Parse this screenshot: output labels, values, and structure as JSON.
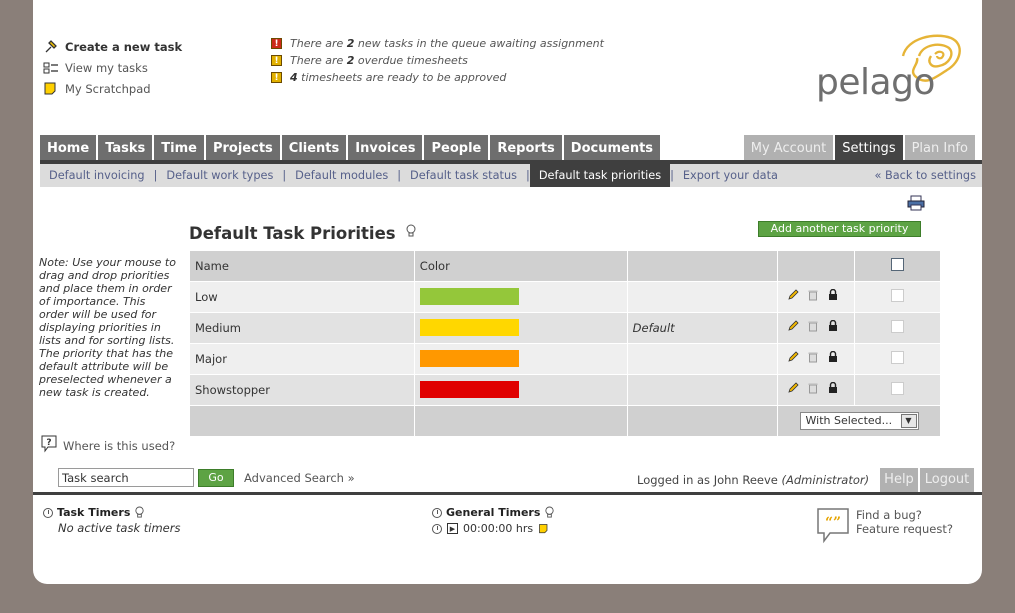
{
  "quick_links": [
    {
      "label": "Create a new task",
      "bold": true
    },
    {
      "label": "View my tasks",
      "bold": false
    },
    {
      "label": "My Scratchpad",
      "bold": false
    }
  ],
  "notices": [
    {
      "pre": "There are ",
      "num": "2",
      "post": " new tasks in the queue awaiting assignment",
      "color": "#cc2a1a"
    },
    {
      "pre": "There are ",
      "num": "2",
      "post": " overdue timesheets",
      "color": "#e2b100"
    },
    {
      "pre": "",
      "num": "4",
      "post": " timesheets are ready to be approved",
      "color": "#e2b100"
    }
  ],
  "logo": {
    "text": "pelago"
  },
  "main_nav": [
    "Home",
    "Tasks",
    "Time",
    "Projects",
    "Clients",
    "Invoices",
    "People",
    "Reports",
    "Documents"
  ],
  "right_nav": [
    {
      "label": "My Account",
      "active": false
    },
    {
      "label": "Settings",
      "active": true
    },
    {
      "label": "Plan Info",
      "active": false
    }
  ],
  "sub_nav": [
    {
      "label": "Default invoicing",
      "active": false
    },
    {
      "label": "Default work types",
      "active": false
    },
    {
      "label": "Default modules",
      "active": false
    },
    {
      "label": "Default task status",
      "active": false
    },
    {
      "label": "Default task priorities",
      "active": true
    },
    {
      "label": "Export your data",
      "active": false
    }
  ],
  "back_link": "« Back to settings",
  "page_title": "Default Task Priorities",
  "add_button": "Add another task priority",
  "note": "Note: Use your mouse to drag and drop priorities and place them in order of importance. This order will be used for displaying priorities in lists and for sorting lists. The priority that has the default attribute will be preselected whenever a new task is created.",
  "where_used": "Where is this used?",
  "table": {
    "headers": [
      "Name",
      "Color"
    ],
    "rows": [
      {
        "name": "Low",
        "color": "#94c73a",
        "default": ""
      },
      {
        "name": "Medium",
        "color": "#ffd700",
        "default": "Default"
      },
      {
        "name": "Major",
        "color": "#ff9800",
        "default": ""
      },
      {
        "name": "Showstopper",
        "color": "#e00000",
        "default": ""
      }
    ],
    "with_selected": "With Selected..."
  },
  "search": {
    "value": "Task search",
    "go": "Go",
    "advanced": "Advanced Search »"
  },
  "logged_in": {
    "prefix": "Logged in as John Reeve ",
    "role": "(Administrator)"
  },
  "help": "Help",
  "logout": "Logout",
  "timers": {
    "task_title": "Task Timers",
    "task_none": "No active task timers",
    "general_title": "General Timers",
    "general_time": "00:00:00 hrs"
  },
  "bug": {
    "line1": "Find a bug?",
    "line2": "Feature request?"
  }
}
